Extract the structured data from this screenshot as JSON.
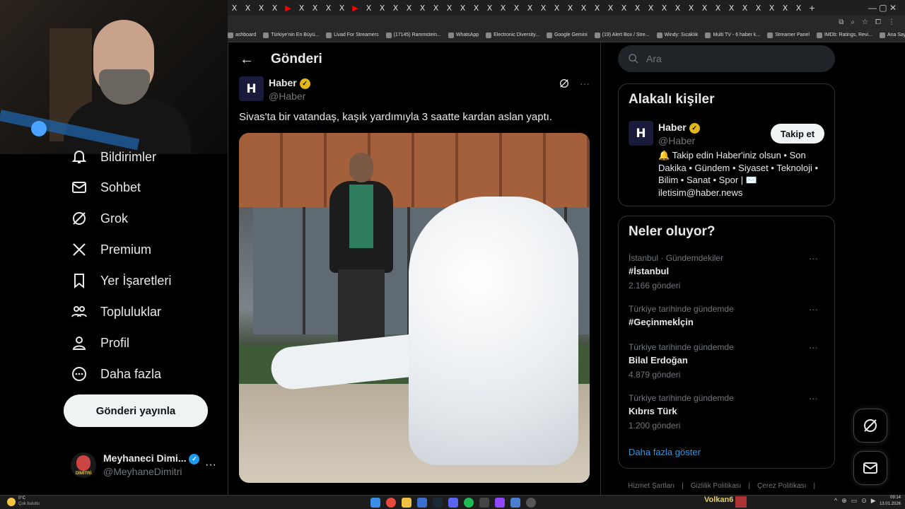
{
  "browser": {
    "tabs": [
      "X",
      "X",
      "X",
      "X",
      "YT",
      "X",
      "X",
      "X",
      "X",
      "YT",
      "X",
      "X",
      "X",
      "X",
      "X",
      "X",
      "X",
      "X",
      "X",
      "X",
      "X",
      "X",
      "X",
      "X",
      "X",
      "X",
      "X",
      "X",
      "X",
      "X",
      "X",
      "X",
      "X",
      "X",
      "X",
      "X",
      "X",
      "X",
      "X",
      "X",
      "X",
      "X",
      "X",
      "+"
    ],
    "bookmarks": [
      "ashboard",
      "Türkiye'nin En Büyü...",
      "Livad For Streamers",
      "(17145) Rammstein...",
      "WhatsApp",
      "Electronic Diversity...",
      "Google Gemini",
      "(19) Alert Box / Stre...",
      "Windy: Sıcaklık",
      "Multi TV - 6 haber k...",
      "Streamer Panel",
      "IMDb: Ratings, Revi...",
      "Ana Sayfa • HBO Max",
      "»",
      "Tüm Yer İşaretleri"
    ]
  },
  "nav": {
    "items": [
      {
        "label": "Bildirimler",
        "icon": "bell-icon"
      },
      {
        "label": "Sohbet",
        "icon": "mail-icon"
      },
      {
        "label": "Grok",
        "icon": "grok-icon"
      },
      {
        "label": "Premium",
        "icon": "x-logo-icon"
      },
      {
        "label": "Yer İşaretleri",
        "icon": "bookmark-icon"
      },
      {
        "label": "Topluluklar",
        "icon": "communities-icon"
      },
      {
        "label": "Profil",
        "icon": "profile-icon"
      },
      {
        "label": "Daha fazla",
        "icon": "more-circle-icon"
      }
    ],
    "post_button": "Gönderi yayınla",
    "account": {
      "name": "Meyhaneci Dimi...",
      "handle": "@MeyhaneDimitri",
      "avatar_text": "DİMİTRİ"
    }
  },
  "post": {
    "header_title": "Gönderi",
    "author_name": "Haber",
    "author_handle": "@Haber",
    "logo_letter": "H",
    "text": "Sivas'ta bir vatandaş, kaşık yardımıyla 3 saatte kardan aslan yaptı."
  },
  "right": {
    "search_placeholder": "Ara",
    "related": {
      "title": "Alakalı kişiler",
      "name": "Haber",
      "handle": "@Haber",
      "follow": "Takip et",
      "bio": "🔔 Takip edin Haber'iniz olsun • Son Dakika • Gündem • Siyaset • Teknoloji • Bilim • Sanat • Spor | ✉️ iletisim@haber.news"
    },
    "trends": {
      "title": "Neler oluyor?",
      "items": [
        {
          "meta": "İstanbul · Gündemdekiler",
          "name": "#İstanbul",
          "count": "2.166 gönderi"
        },
        {
          "meta": "Türkiye tarihinde gündemde",
          "name": "#Geçinmekİçin",
          "count": ""
        },
        {
          "meta": "Türkiye tarihinde gündemde",
          "name": "Bilal Erdoğan",
          "count": "4.879 gönderi"
        },
        {
          "meta": "Türkiye tarihinde gündemde",
          "name": "Kıbrıs Türk",
          "count": "1.200 gönderi"
        }
      ],
      "show_more": "Daha fazla göster"
    },
    "footer": [
      "Hizmet Şartları",
      "|",
      "Gizlilik Politikası",
      "|",
      "Çerez Politikası",
      "|"
    ]
  },
  "taskbar": {
    "weather_temp": "0°C",
    "weather_desc": "Çok bulutlu",
    "user": "Volkan6",
    "time": "09:14",
    "date": "13.01.2026"
  }
}
